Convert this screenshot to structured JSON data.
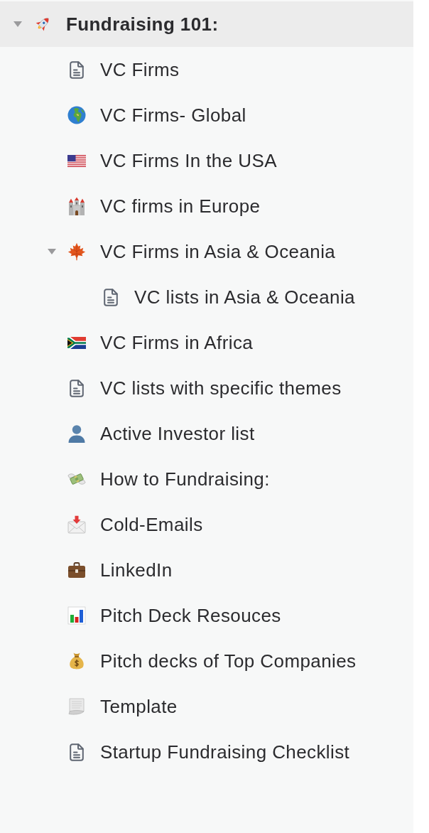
{
  "sidebar": {
    "tree": [
      {
        "label": "Fundraising 101:",
        "kind": "rocket",
        "selected": true,
        "expanded": true,
        "children": [
          {
            "label": "VC Firms",
            "kind": "page",
            "selected": false
          },
          {
            "label": "VC Firms- Global",
            "kind": "globe",
            "selected": false
          },
          {
            "label": "VC Firms In the USA",
            "kind": "usflag",
            "selected": false
          },
          {
            "label": "VC firms in Europe",
            "kind": "castle",
            "selected": false
          },
          {
            "label": "VC Firms in Asia & Oceania",
            "kind": "leaf",
            "selected": false,
            "expanded": true,
            "children": [
              {
                "label": "VC lists in Asia & Oceania",
                "kind": "page",
                "selected": false
              }
            ]
          },
          {
            "label": "VC Firms in Africa",
            "kind": "zaflag",
            "selected": false
          },
          {
            "label": "VC lists with specific themes",
            "kind": "page",
            "selected": false
          },
          {
            "label": "Active Investor list",
            "kind": "person",
            "selected": false
          },
          {
            "label": "How to Fundraising:",
            "kind": "money",
            "selected": false
          },
          {
            "label": "Cold-Emails",
            "kind": "envelope",
            "selected": false
          },
          {
            "label": "LinkedIn",
            "kind": "briefcase",
            "selected": false
          },
          {
            "label": "Pitch Deck Resouces",
            "kind": "chart",
            "selected": false
          },
          {
            "label": "Pitch decks of Top Companies",
            "kind": "moneybag",
            "selected": false
          },
          {
            "label": "Template",
            "kind": "scroll",
            "selected": false
          },
          {
            "label": "Startup Fundraising Checklist",
            "kind": "page",
            "selected": false
          }
        ]
      }
    ]
  }
}
